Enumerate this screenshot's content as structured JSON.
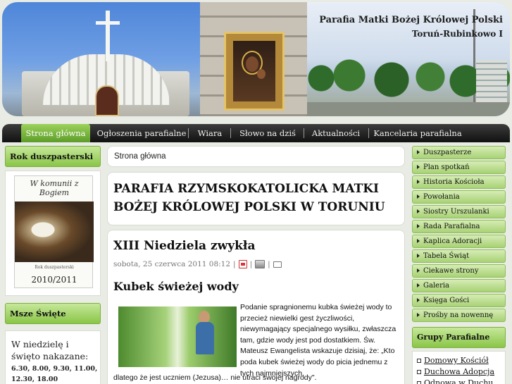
{
  "header": {
    "title": "Parafia Matki Bożej Królowej Polski",
    "subtitle": "Toruń-Rubinkowo I"
  },
  "nav": {
    "items": [
      "Strona główna",
      "Ogłoszenia parafialne",
      "Wiara",
      "Słowo na dziś",
      "Aktualności",
      "Kancelaria parafialna"
    ],
    "active_index": 0
  },
  "left": {
    "rok": {
      "title": "Rok duszpasterski",
      "book_heading": "W komunii z Bogiem",
      "book_subtitle": "Rok duszpasterski",
      "book_year": "2010/2011"
    },
    "msze": {
      "title": "Msze Święte",
      "lead": "W niedzielę i święto nakazane:",
      "times_line1": "6.30, 8.00, 9.30, 11.00,",
      "times_line2": "12.30, 18.00"
    }
  },
  "main": {
    "breadcrumb": "Strona główna",
    "page_title": "PARAFIA RZYMSKOKATOLICKA MATKI BOŻEJ KRÓLOWEJ POLSKI W TORUNIU",
    "article": {
      "title": "XIII Niedziela zwykła",
      "date": "sobota, 25 czerwca 2011 08:12",
      "separator": "|",
      "subtitle": "Kubek świeżej wody",
      "body_wrap": "Podanie spragnionemu kubka świeżej wody to przecież niewielki gest życzliwości, niewymagający specjalnego wysiłku, zwłaszcza tam, gdzie wody jest pod dostatkiem. Św. Mateusz Ewangelista wskazuje dzisiaj, że: „Kto poda kubek świeżej wody do picia jednemu z tych najmniejszych,",
      "body_full": "dlatego że jest uczniem (Jezusa)… nie utraci swojej nagrody\"."
    },
    "icons": [
      "pdf-icon",
      "print-icon",
      "email-icon"
    ]
  },
  "right": {
    "menu": [
      "Duszpasterze",
      "Plan spotkań",
      "Historia Kościoła",
      "Powołania",
      "Siostry Urszulanki",
      "Rada Parafialna",
      "Kaplica Adoracji",
      "Tabela Świąt",
      "Ciekawe strony",
      "Galeria",
      "Księga Gości",
      "Prośby na nowennę"
    ],
    "groups_title": "Grupy Parafialne",
    "groups": [
      "Domowy Kościół",
      "Duchowa Adopcja",
      "Odnowa w Duchu"
    ]
  },
  "colors": {
    "accent_green": "#8ac548",
    "nav_dark": "#1a1a1a",
    "page_bg": "#e9ece4"
  }
}
